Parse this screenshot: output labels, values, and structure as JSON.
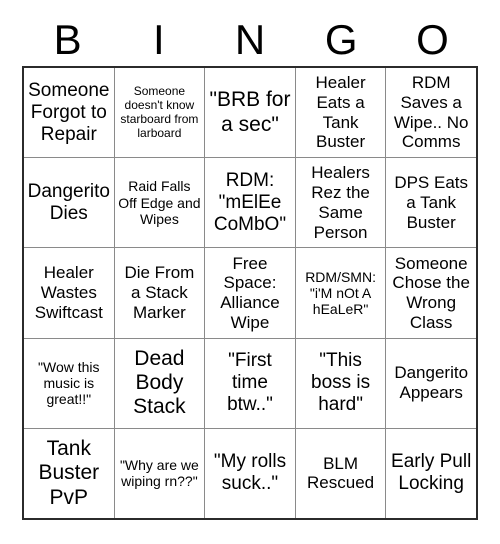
{
  "card": {
    "header_letters": [
      "B",
      "I",
      "N",
      "G",
      "O"
    ],
    "colors": {
      "background": "#ffffff",
      "text": "#000000",
      "outer_border": "#2b2b2b",
      "inner_border": "#8a8a8a"
    },
    "rows": [
      [
        {
          "text": "Someone Forgot to Repair",
          "size": "lg"
        },
        {
          "text": "Someone doesn't know starboard from larboard",
          "size": "xs"
        },
        {
          "text": "\"BRB for a sec\"",
          "size": "xl"
        },
        {
          "text": "Healer Eats a Tank Buster",
          "size": "md"
        },
        {
          "text": "RDM Saves a Wipe.. No Comms",
          "size": "md"
        }
      ],
      [
        {
          "text": "Dangerito Dies",
          "size": "lg"
        },
        {
          "text": "Raid Falls Off Edge and Wipes",
          "size": "sm"
        },
        {
          "text": "RDM: \"mElEe CoMbO\"",
          "size": "lg"
        },
        {
          "text": "Healers Rez the Same Person",
          "size": "md"
        },
        {
          "text": "DPS Eats a Tank Buster",
          "size": "md"
        }
      ],
      [
        {
          "text": "Healer Wastes Swiftcast",
          "size": "md"
        },
        {
          "text": "Die From a Stack Marker",
          "size": "md"
        },
        {
          "text": "Free Space: Alliance Wipe",
          "size": "md"
        },
        {
          "text": "RDM/SMN: \"i'M nOt A hEaLeR\"",
          "size": "sm"
        },
        {
          "text": "Someone Chose the Wrong Class",
          "size": "md"
        }
      ],
      [
        {
          "text": "\"Wow this music is great!!\"",
          "size": "sm"
        },
        {
          "text": "Dead Body Stack",
          "size": "xl"
        },
        {
          "text": "\"First time btw..\"",
          "size": "lg"
        },
        {
          "text": "\"This boss is hard\"",
          "size": "lg"
        },
        {
          "text": "Dangerito Appears",
          "size": "md"
        }
      ],
      [
        {
          "text": "Tank Buster PvP",
          "size": "xl"
        },
        {
          "text": "\"Why are we wiping rn??\"",
          "size": "sm"
        },
        {
          "text": "\"My rolls suck..\"",
          "size": "lg"
        },
        {
          "text": "BLM Rescued",
          "size": "md"
        },
        {
          "text": "Early Pull Locking",
          "size": "lg"
        }
      ]
    ]
  }
}
